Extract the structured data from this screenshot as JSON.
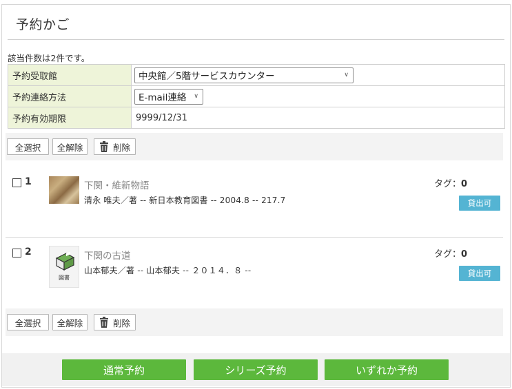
{
  "page": {
    "title": "予約かご",
    "count_text": "該当件数は2件です。"
  },
  "settings": [
    {
      "label": "予約受取館",
      "value": "中央館／5階サービスカウンター",
      "kind": "select"
    },
    {
      "label": "予約連絡方法",
      "value": "E-mail連絡",
      "kind": "select"
    },
    {
      "label": "予約有効期限",
      "value": "9999/12/31",
      "kind": "text"
    }
  ],
  "toolbar": {
    "select_all": "全選択",
    "deselect_all": "全解除",
    "delete": "削除"
  },
  "items": [
    {
      "number": "1",
      "title": "下関・維新物語",
      "meta": "清永 唯夫／著 -- 新日本教育図書 -- 2004.8 -- 217.7",
      "tag_label": "タグ：",
      "tag_count": "0",
      "status": "貸出可",
      "thumbnail": "cover-image"
    },
    {
      "number": "2",
      "title": "下関の古道",
      "meta": "山本郁夫／著 -- 山本郁夫 -- ２０１４．８ --",
      "tag_label": "タグ：",
      "tag_count": "0",
      "status": "貸出可",
      "thumbnail": "book-icon",
      "thumbnail_caption": "図書"
    }
  ],
  "footer": {
    "normal": "通常予約",
    "series": "シリーズ予約",
    "either": "いずれか予約"
  },
  "colors": {
    "label_bg": "#eef4d9",
    "status_bg": "#54b4d3",
    "action_green": "#5cb83c"
  }
}
